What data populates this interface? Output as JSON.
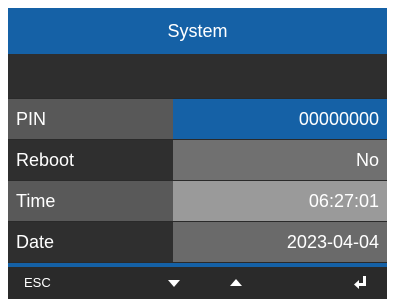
{
  "header": {
    "title": "System"
  },
  "settings": [
    {
      "label": "PIN",
      "value": "00000000"
    },
    {
      "label": "Reboot",
      "value": "No"
    },
    {
      "label": "Time",
      "value": "06:27:01"
    },
    {
      "label": "Date",
      "value": "2023-04-04"
    }
  ],
  "footer": {
    "esc_label": "ESC",
    "down_icon": "triangle-down-icon",
    "up_icon": "triangle-up-icon",
    "enter_icon": "enter-return-icon"
  },
  "colors": {
    "accent": "#1561a6",
    "background": "#2a2a2a",
    "text": "#ffffff"
  }
}
